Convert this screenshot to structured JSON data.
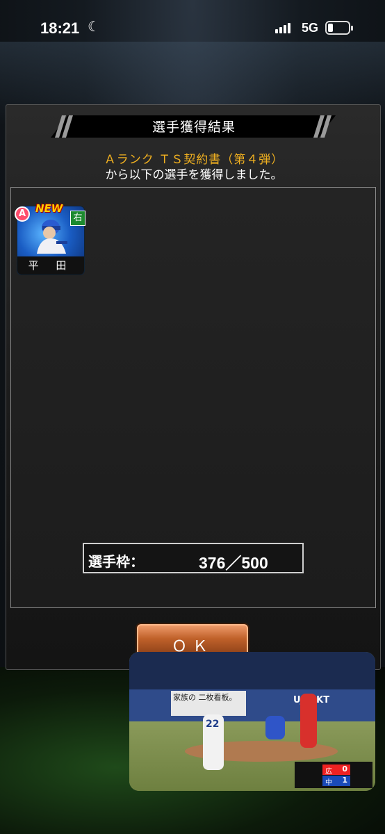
{
  "status_bar": {
    "time": "18:21",
    "network": "5G"
  },
  "dialog": {
    "title": "選手獲得結果",
    "source_line": "Ａランク ＴＳ契約書（第４弾）",
    "result_line": "から以下の選手を獲得しました。",
    "players": [
      {
        "new_tag": "NEW",
        "rank": "A",
        "handedness": "右",
        "name": "平 田"
      }
    ],
    "quota": {
      "label": "選手枠：",
      "value": "376／500"
    },
    "ok_button": "ＯＫ"
  },
  "pip": {
    "ad_text": "家族の 二枚看板。",
    "ad_text2": "UJTEKT",
    "pitcher_number": "22",
    "score": {
      "team1": "広",
      "team1_runs": "0",
      "team2": "中",
      "team2_runs": "1"
    }
  },
  "colors": {
    "source_text": "#f0b020",
    "ok_button": "#c0612a",
    "card_bg": "#1a5dc4"
  }
}
